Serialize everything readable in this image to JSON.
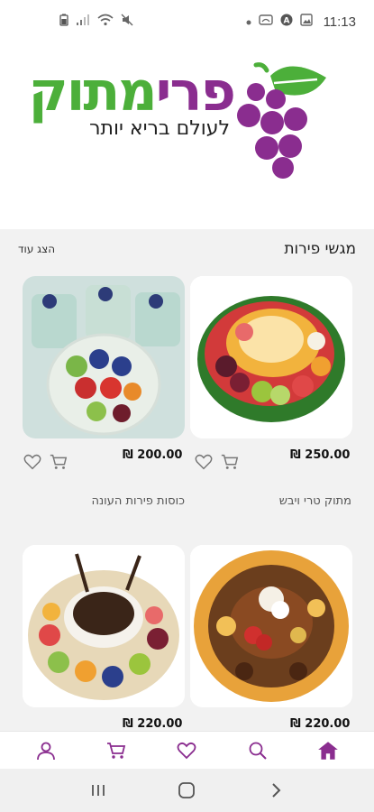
{
  "status_bar": {
    "time": "11:13",
    "icons": [
      "battery-icon",
      "signal-icon",
      "wifi-icon",
      "mute-icon",
      "dot-icon",
      "cast-icon",
      "a-icon",
      "image-icon"
    ]
  },
  "header": {
    "logo_part1": "פרי",
    "logo_part2": "מתוק",
    "tagline": "לעולם בריא יותר"
  },
  "section": {
    "title": "מגשי פירות",
    "show_more": "הצג עוד"
  },
  "products": [
    {
      "price": "250.00 ₪",
      "name": "מתוק טרי ויבש"
    },
    {
      "price": "200.00 ₪",
      "name": "כוסות פירות העונה"
    },
    {
      "price": "220.00 ₪",
      "name": ""
    },
    {
      "price": "220.00 ₪",
      "name": ""
    }
  ],
  "bottom_nav": [
    "home-icon",
    "search-icon",
    "heart-icon",
    "cart-icon",
    "user-icon"
  ],
  "colors": {
    "brand_purple": "#8a2d8f",
    "brand_green": "#4caf3a"
  }
}
